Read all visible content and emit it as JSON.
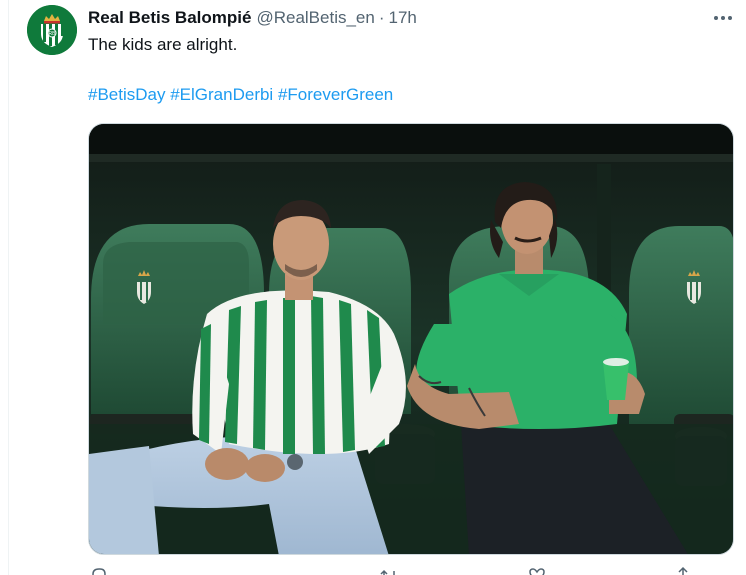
{
  "tweet": {
    "author": {
      "display_name": "Real Betis Balompié",
      "handle": "@RealBetis_en",
      "separator": "·",
      "time": "17h",
      "avatar_icon": "real-betis-crest-icon"
    },
    "text": "The kids are alright.",
    "hashtags": [
      "#BetisDay",
      "#ElGranDerbi",
      "#ForeverGreen"
    ],
    "more_icon": "more-options-icon"
  },
  "media": {
    "type": "photo",
    "crest_icon": "betis-crest-seat-emblem-icon"
  },
  "colors": {
    "link": "#1d9bf0",
    "secondary_text": "#536471",
    "primary_text": "#0f1419",
    "betis_green": "#0f7a3b"
  },
  "actions": [
    {
      "icon": "reply-icon"
    },
    {
      "icon": "retweet-icon"
    },
    {
      "icon": "like-icon"
    },
    {
      "icon": "views-icon"
    },
    {
      "icon": "bookmark-icon"
    },
    {
      "icon": "share-icon"
    }
  ]
}
